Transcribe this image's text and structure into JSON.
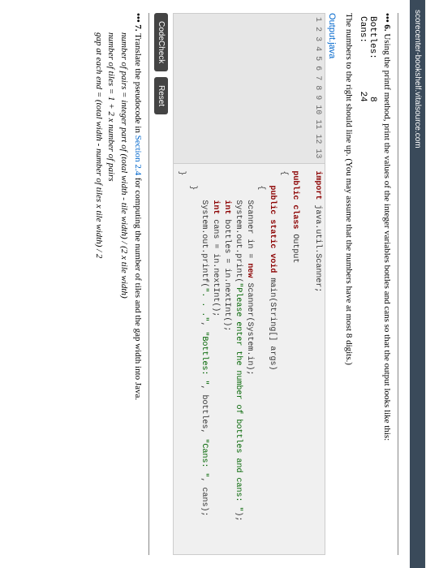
{
  "header": {
    "site": "scorecenter-bookshelf.vitalsource.com"
  },
  "p6": {
    "number": "••• 6.",
    "intro": "Using the printf method, print the values of the integer variables bottles and cans so that the output looks like this:",
    "example_label1": "Bottles:",
    "example_value1": "8",
    "example_label2": "Cans:",
    "example_value2": "24",
    "note": "The numbers to the right should line up. (You may assume that the numbers have at most 8 digits.)"
  },
  "file": {
    "name": "Output.java"
  },
  "code": {
    "linenos": [
      "1",
      "2",
      "3",
      "4",
      "5",
      "6",
      "7",
      "8",
      "9",
      "10",
      "11",
      "12",
      "13"
    ],
    "l1a": "import",
    "l1b": " java.util.Scanner;",
    "l3a": "public class",
    "l3b": " Output",
    "l4": "{",
    "l5a": "   public static void",
    "l5b": " main(String[] args)",
    "l6": "   {",
    "l7": "      Scanner in = ",
    "l7b": "new",
    "l7c": " Scanner(System.in);",
    "l8a": "      System.out.print(",
    "l8b": "\"Please enter the number of bottles and cans: \"",
    "l8c": ");",
    "l9a": "      int",
    "l9b": " bottles = in.nextInt();",
    "l10a": "      int",
    "l10b": " cans = in.nextInt();",
    "l11a": "      System.out.printf(",
    "l11b": "\". . .\"",
    "l11c": ", ",
    "l11d": "\"Bottles: \"",
    "l11e": ", bottles, ",
    "l11f": "\"Cans: \"",
    "l11g": ", cans);",
    "l12": "   }",
    "l13": "}"
  },
  "buttons": {
    "check": "CodeCheck",
    "reset": "Reset"
  },
  "p7": {
    "number": "••• 7.",
    "intro_a": "Translate the pseudocode in ",
    "section": "Section 2.4",
    "intro_b": " for computing the number of tiles and the gap width into Java.",
    "f1": "number of pairs = integer part of (total width - tile width) / (2 x tile width)",
    "f2": "number of tiles = 1 + 2 x number of pairs",
    "f3": "gap at each end = (total width - number of tiles x tile width) / 2"
  }
}
